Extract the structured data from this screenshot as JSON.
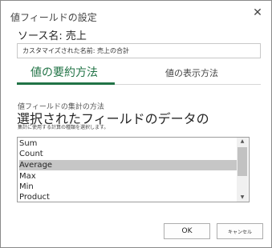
{
  "dialog": {
    "title": "値フィールドの設定",
    "close_glyph": "✕"
  },
  "source": {
    "text": "ソース名: 売上"
  },
  "custom_name": {
    "label": "カスタマイズされた名前:",
    "value": "売上の合計",
    "display": "カスタマイズされた名前: 売上の合計"
  },
  "tabs": [
    {
      "label": "値の要約方法",
      "active": true
    },
    {
      "label": "値の表示方法",
      "active": false
    }
  ],
  "summary_section": {
    "label": "値フィールドの集計の方法",
    "heading": "選択されたフィールドのデータの",
    "description": "集計に使用する計算の種類を選択します。"
  },
  "functions": {
    "items": [
      "Sum",
      "Count",
      "Average",
      "Max",
      "Min",
      "Product"
    ],
    "selected": "Average"
  },
  "scrollbar": {
    "up_icon": "▲",
    "down_icon": "▼"
  },
  "buttons": {
    "ok": "OK",
    "cancel": "キャンセル"
  },
  "colors": {
    "accent": "#217346",
    "selection": "#c6c6c6"
  }
}
